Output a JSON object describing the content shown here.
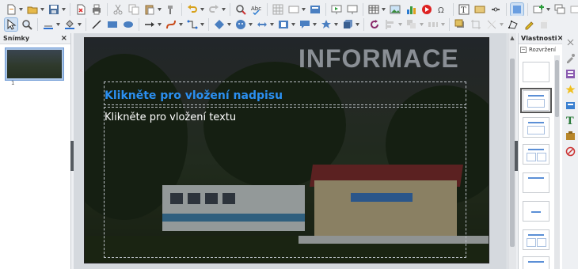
{
  "slides_panel": {
    "title": "Snímky",
    "close": "×",
    "thumb_number": "1"
  },
  "properties_panel": {
    "title": "Vlastnosti",
    "close": "×",
    "section": "Rozvržení",
    "collapse": "−"
  },
  "slide": {
    "heading": "INFORMACE",
    "title_placeholder": "Klikněte pro vložení nadpisu",
    "content_placeholder": "Klikněte pro vložení textu"
  },
  "toolbar_icons": {
    "row1": [
      "new-icon",
      "open-icon",
      "save-icon",
      "export-pdf-icon",
      "print-icon",
      "cut-icon",
      "copy-icon",
      "paste-icon",
      "clone-formatting-icon",
      "undo-icon",
      "redo-icon",
      "find-replace-icon",
      "spelling-icon",
      "grid-icon",
      "display-views-icon",
      "master-slide-icon",
      "start-presentation-icon",
      "presenter-icon",
      "table-icon",
      "image-icon",
      "chart-icon",
      "media-icon",
      "special-character-icon",
      "text-box-icon",
      "fontwork-icon",
      "hyperlink-icon",
      "show-draw-functions-icon",
      "new-slide-icon",
      "duplicate-slide-icon",
      "delete-slide-icon",
      "slide-layout-icon"
    ],
    "row2": [
      "select-icon",
      "zoom-icon",
      "line-color-icon",
      "fill-color-icon",
      "line-icon",
      "rectangle-icon",
      "ellipse-icon",
      "lines-arrows-icon",
      "curves-icon",
      "connectors-icon",
      "basic-shapes-icon",
      "symbol-shapes-icon",
      "block-arrows-icon",
      "flowchart-icon",
      "callouts-icon",
      "stars-icon",
      "3d-objects-icon",
      "rotate-icon",
      "align-icon",
      "arrange-icon",
      "distribute-icon",
      "shadow-icon",
      "crop-icon",
      "filter-icon",
      "points-icon",
      "glue-points-icon",
      "toggle-extrusion-icon"
    ]
  },
  "side_tabs": [
    "properties-tab-icon",
    "slide-transition-icon",
    "custom-animation-icon",
    "master-slides-icon",
    "styles-icon",
    "gallery-icon",
    "navigator-icon"
  ],
  "colors": {
    "title_text": "#2b8ff0",
    "heading_text": "#8a8f95",
    "panel_bg": "#eef0f3",
    "selected": "#cfe0f3"
  }
}
